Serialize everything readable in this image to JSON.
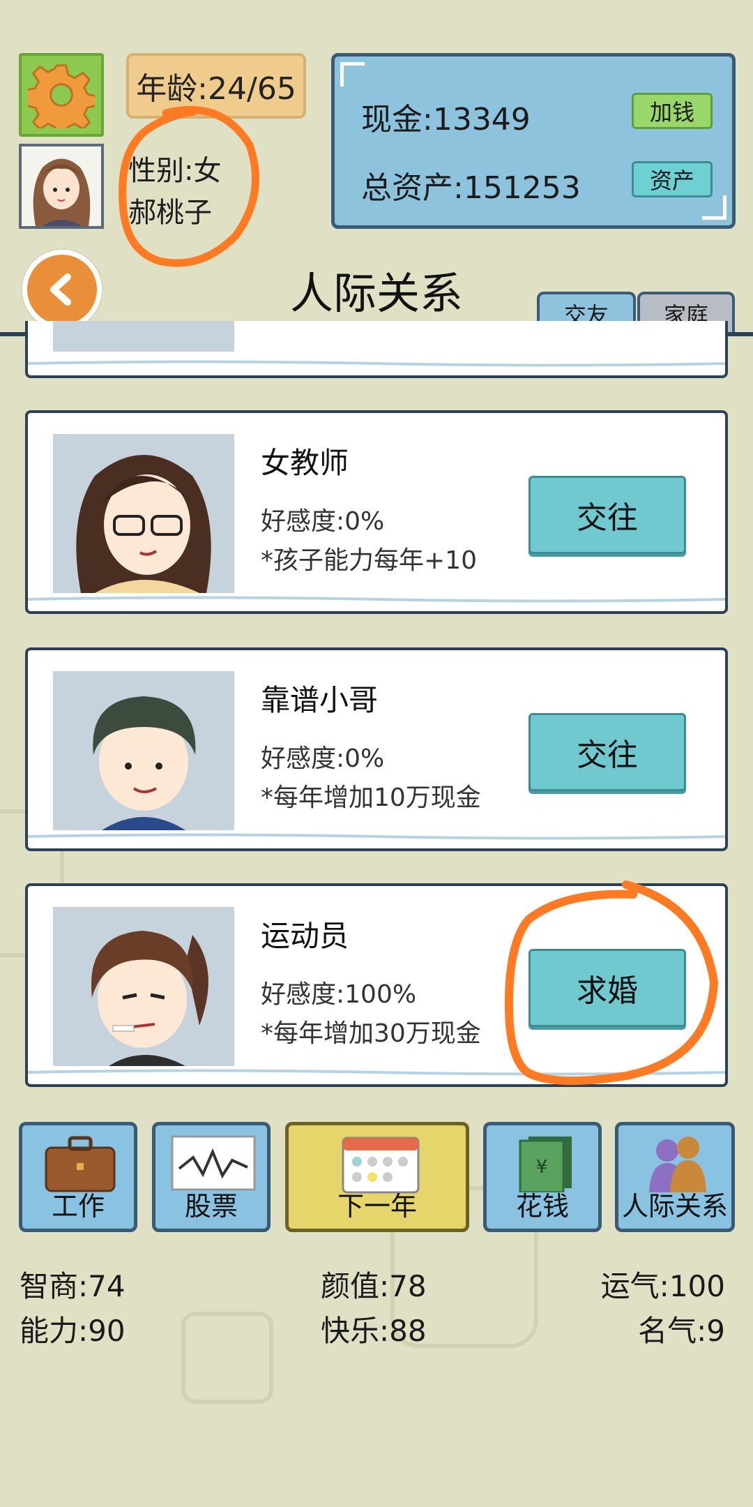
{
  "header": {
    "age_label": "年龄:24/65",
    "gender_label": "性别:女",
    "player_name": "郝桃子"
  },
  "money": {
    "cash_label": "现金:",
    "cash_value": "13349",
    "add_money_button": "加钱",
    "assets_label": "总资产:",
    "assets_value": "151253",
    "assets_button": "资产"
  },
  "page": {
    "title": "人际关系",
    "tabs": [
      "交友",
      "家庭"
    ]
  },
  "contacts": [
    {
      "name": "女教师",
      "favor": "好感度:0%",
      "perk": "*孩子能力每年+10",
      "action": "交往"
    },
    {
      "name": "靠谱小哥",
      "favor": "好感度:0%",
      "perk": "*每年增加10万现金",
      "action": "交往"
    },
    {
      "name": "运动员",
      "favor": "好感度:100%",
      "perk": "*每年增加30万现金",
      "action": "求婚"
    }
  ],
  "bottom_nav": [
    {
      "label": "工作",
      "icon": "briefcase-icon"
    },
    {
      "label": "股票",
      "icon": "stock-chart-icon"
    },
    {
      "label": "下一年",
      "icon": "calendar-icon"
    },
    {
      "label": "花钱",
      "icon": "money-bills-icon"
    },
    {
      "label": "人际关系",
      "icon": "people-icon"
    }
  ],
  "stats": {
    "iq": "智商:74",
    "looks": "颜值:78",
    "luck": "运气:100",
    "ability": "能力:90",
    "happiness": "快乐:88",
    "fame": "名气:9"
  },
  "colors": {
    "background": "#dfe0c4",
    "accent_orange": "#e98f3a",
    "panel_blue": "#8ec3de",
    "button_teal": "#6fc9cf",
    "button_green": "#9ad76a",
    "annotation_orange": "#ff7a22"
  }
}
